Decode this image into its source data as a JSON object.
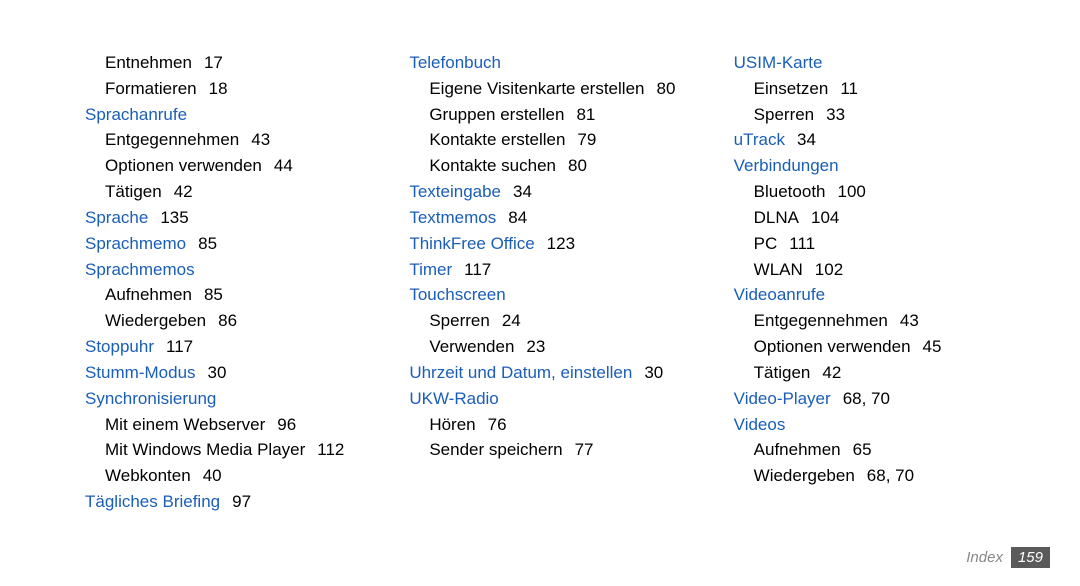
{
  "columns": [
    [
      {
        "type": "sub",
        "label": "Entnehmen",
        "page": "17"
      },
      {
        "type": "sub",
        "label": "Formatieren",
        "page": "18"
      },
      {
        "type": "heading",
        "label": "Sprachanrufe"
      },
      {
        "type": "sub",
        "label": "Entgegennehmen",
        "page": "43"
      },
      {
        "type": "sub",
        "label": "Optionen verwenden",
        "page": "44"
      },
      {
        "type": "sub",
        "label": "Tätigen",
        "page": "42"
      },
      {
        "type": "heading",
        "label": "Sprache",
        "page": "135"
      },
      {
        "type": "heading",
        "label": "Sprachmemo",
        "page": "85"
      },
      {
        "type": "heading",
        "label": "Sprachmemos"
      },
      {
        "type": "sub",
        "label": "Aufnehmen",
        "page": "85"
      },
      {
        "type": "sub",
        "label": "Wiedergeben",
        "page": "86"
      },
      {
        "type": "heading",
        "label": "Stoppuhr",
        "page": "117"
      },
      {
        "type": "heading",
        "label": "Stumm-Modus",
        "page": "30"
      },
      {
        "type": "heading",
        "label": "Synchronisierung"
      },
      {
        "type": "sub",
        "label": "Mit einem Webserver",
        "page": "96"
      },
      {
        "type": "sub",
        "label": "Mit Windows Media Player",
        "page": "112"
      },
      {
        "type": "sub",
        "label": "Webkonten",
        "page": "40"
      },
      {
        "type": "heading",
        "label": "Tägliches Briefing",
        "page": "97"
      }
    ],
    [
      {
        "type": "heading",
        "label": "Telefonbuch"
      },
      {
        "type": "sub",
        "label": "Eigene Visitenkarte erstellen",
        "page": "80"
      },
      {
        "type": "sub",
        "label": "Gruppen erstellen",
        "page": "81"
      },
      {
        "type": "sub",
        "label": "Kontakte erstellen",
        "page": "79"
      },
      {
        "type": "sub",
        "label": "Kontakte suchen",
        "page": "80"
      },
      {
        "type": "heading",
        "label": "Texteingabe",
        "page": "34"
      },
      {
        "type": "heading",
        "label": "Textmemos",
        "page": "84"
      },
      {
        "type": "heading",
        "label": "ThinkFree Office",
        "page": "123"
      },
      {
        "type": "heading",
        "label": "Timer",
        "page": "117"
      },
      {
        "type": "heading",
        "label": "Touchscreen"
      },
      {
        "type": "sub",
        "label": "Sperren",
        "page": "24"
      },
      {
        "type": "sub",
        "label": "Verwenden",
        "page": "23"
      },
      {
        "type": "heading",
        "label": "Uhrzeit und Datum, einstellen",
        "page": "30"
      },
      {
        "type": "heading",
        "label": "UKW-Radio"
      },
      {
        "type": "sub",
        "label": "Hören",
        "page": "76"
      },
      {
        "type": "sub",
        "label": "Sender speichern",
        "page": "77"
      }
    ],
    [
      {
        "type": "heading",
        "label": "USIM-Karte"
      },
      {
        "type": "sub",
        "label": "Einsetzen",
        "page": "11"
      },
      {
        "type": "sub",
        "label": "Sperren",
        "page": "33"
      },
      {
        "type": "heading",
        "label": "uTrack",
        "page": "34"
      },
      {
        "type": "heading",
        "label": "Verbindungen"
      },
      {
        "type": "sub",
        "label": "Bluetooth",
        "page": "100"
      },
      {
        "type": "sub",
        "label": "DLNA",
        "page": "104"
      },
      {
        "type": "sub",
        "label": "PC",
        "page": "111"
      },
      {
        "type": "sub",
        "label": "WLAN",
        "page": "102"
      },
      {
        "type": "heading",
        "label": "Videoanrufe"
      },
      {
        "type": "sub",
        "label": "Entgegennehmen",
        "page": "43"
      },
      {
        "type": "sub",
        "label": "Optionen verwenden",
        "page": "45"
      },
      {
        "type": "sub",
        "label": "Tätigen",
        "page": "42"
      },
      {
        "type": "heading",
        "label": "Video-Player",
        "page": "68, 70"
      },
      {
        "type": "heading",
        "label": "Videos"
      },
      {
        "type": "sub",
        "label": "Aufnehmen",
        "page": "65"
      },
      {
        "type": "sub",
        "label": "Wiedergeben",
        "page": "68, 70"
      }
    ]
  ],
  "footer": {
    "label": "Index",
    "page": "159"
  }
}
